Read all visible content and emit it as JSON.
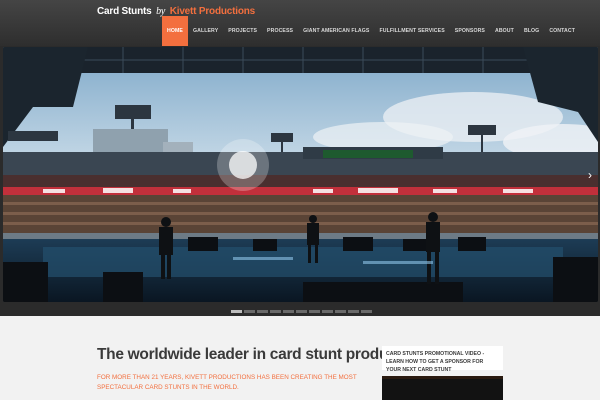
{
  "header": {
    "logo": {
      "part1": "Card Stunts",
      "by": "by",
      "brand": "Kivett Productions"
    },
    "nav": [
      {
        "label": "HOME",
        "active": true
      },
      {
        "label": "GALLERY"
      },
      {
        "label": "PROJECTS"
      },
      {
        "label": "PROCESS"
      },
      {
        "label": "GIANT AMERICAN FLAGS"
      },
      {
        "label": "FULFILLMENT SERVICES"
      },
      {
        "label": "SPONSORS"
      },
      {
        "label": "ABOUT"
      },
      {
        "label": "BLOG"
      },
      {
        "label": "CONTACT"
      }
    ]
  },
  "slider": {
    "prev_icon": "chevron-left-icon",
    "next_icon": "chevron-right-icon",
    "slide_count": 11,
    "active_slide": 1
  },
  "main": {
    "headline": "The worldwide leader in card stunt productions.",
    "intro": "FOR MORE THAN 21 YEARS, KIVETT PRODUCTIONS HAS BEEN CREATING THE MOST SPECTACULAR CARD STUNTS IN THE WORLD."
  },
  "sidebar": {
    "promo_title": "CARD STUNTS PROMOTIONAL VIDEO - LEARN HOW TO GET A SPONSOR FOR YOUR NEXT CARD STUNT"
  },
  "colors": {
    "accent": "#f36f3e",
    "header_bg": "#3a3a3a",
    "content_bg": "#f2f2f2"
  }
}
